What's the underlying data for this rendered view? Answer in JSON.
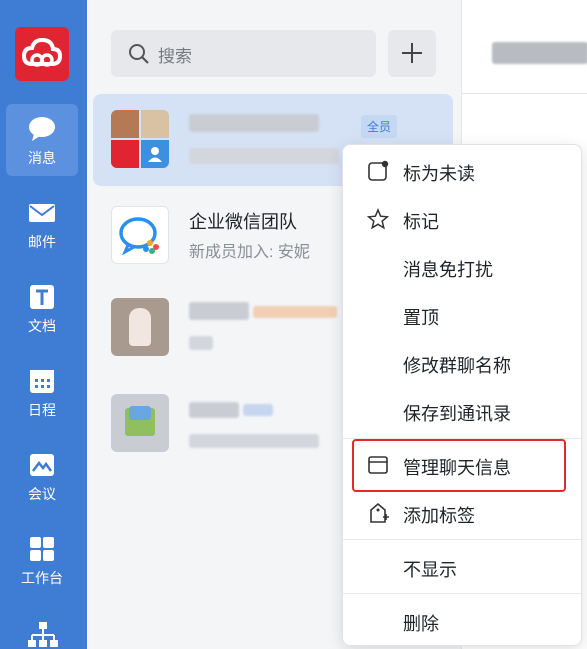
{
  "nav": {
    "items": [
      {
        "label": "消息",
        "icon": "chat-bubble-icon",
        "active": true
      },
      {
        "label": "邮件",
        "icon": "mail-icon"
      },
      {
        "label": "文档",
        "icon": "document-icon"
      },
      {
        "label": "日程",
        "icon": "calendar-icon"
      },
      {
        "label": "会议",
        "icon": "meeting-icon"
      },
      {
        "label": "工作台",
        "icon": "grid-apps-icon"
      }
    ],
    "brand_color": "#e02432",
    "rail_color": "#3f7cd4"
  },
  "search": {
    "placeholder": "搜索"
  },
  "conversations": [
    {
      "title": "",
      "subtitle": "",
      "tag": "全员",
      "active": true
    },
    {
      "title": "企业微信团队",
      "subtitle": "新成员加入: 安妮"
    },
    {
      "title": "",
      "subtitle": ""
    },
    {
      "title": "",
      "subtitle": ""
    }
  ],
  "context_menu": {
    "items": [
      {
        "label": "标为未读",
        "icon": "mark-unread-icon"
      },
      {
        "label": "标记",
        "icon": "star-icon"
      },
      {
        "label": "消息免打扰",
        "icon": ""
      },
      {
        "label": "置顶",
        "icon": ""
      },
      {
        "label": "修改群聊名称",
        "icon": ""
      },
      {
        "label": "保存到通讯录",
        "icon": ""
      },
      {
        "label": "管理聊天信息",
        "icon": "window-icon",
        "highlighted": true
      },
      {
        "label": "添加标签",
        "icon": "add-tag-icon"
      },
      {
        "label": "不显示",
        "icon": ""
      },
      {
        "label": "删除",
        "icon": ""
      }
    ]
  }
}
